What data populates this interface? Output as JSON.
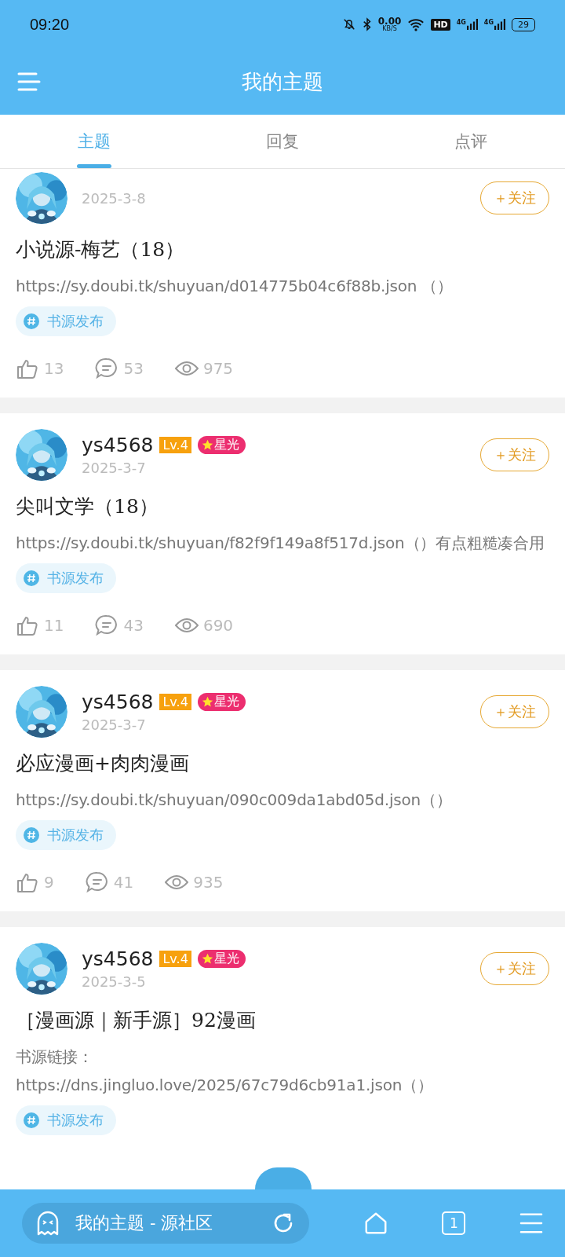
{
  "status_bar": {
    "time": "09:20",
    "net_speed": "0.00",
    "net_unit": "KB/S",
    "hd": "HD",
    "signals": [
      "4G",
      "4G"
    ],
    "battery": "29"
  },
  "app_bar": {
    "title": "我的主题"
  },
  "tabs": [
    {
      "label": "主题",
      "selected": true
    },
    {
      "label": "回复",
      "selected": false
    },
    {
      "label": "点评",
      "selected": false
    }
  ],
  "posts": [
    {
      "date": "2025-3-8",
      "follow": "＋关注",
      "title": "小说源-梅艺（18）",
      "body": "https://sy.doubi.tk/shuyuan/d014775b04c6f88b.json （）",
      "tag": "书源发布",
      "likes": "13",
      "comments": "53",
      "views": "975"
    },
    {
      "user": "ys4568",
      "level": "Lv.4",
      "rank": "星光",
      "date": "2025-3-7",
      "follow": "＋关注",
      "title": "尖叫文学（18）",
      "body": "https://sy.doubi.tk/shuyuan/f82f9f149a8f517d.json（）有点粗糙凑合用",
      "tag": "书源发布",
      "likes": "11",
      "comments": "43",
      "views": "690"
    },
    {
      "user": "ys4568",
      "level": "Lv.4",
      "rank": "星光",
      "date": "2025-3-7",
      "follow": "＋关注",
      "title": "必应漫画+肉肉漫画",
      "body": "https://sy.doubi.tk/shuyuan/090c009da1abd05d.json（）",
      "tag": "书源发布",
      "likes": "9",
      "comments": "41",
      "views": "935"
    },
    {
      "user": "ys4568",
      "level": "Lv.4",
      "rank": "星光",
      "date": "2025-3-5",
      "follow": "＋关注",
      "title": "［漫画源｜新手源］92漫画",
      "body": "书源链接：\nhttps://dns.jingluo.love/2025/67c79d6cb91a1.json（）",
      "tag": "书源发布"
    }
  ],
  "bottom_bar": {
    "page_title": "我的主题 - 源社区",
    "tab_count": "1"
  }
}
